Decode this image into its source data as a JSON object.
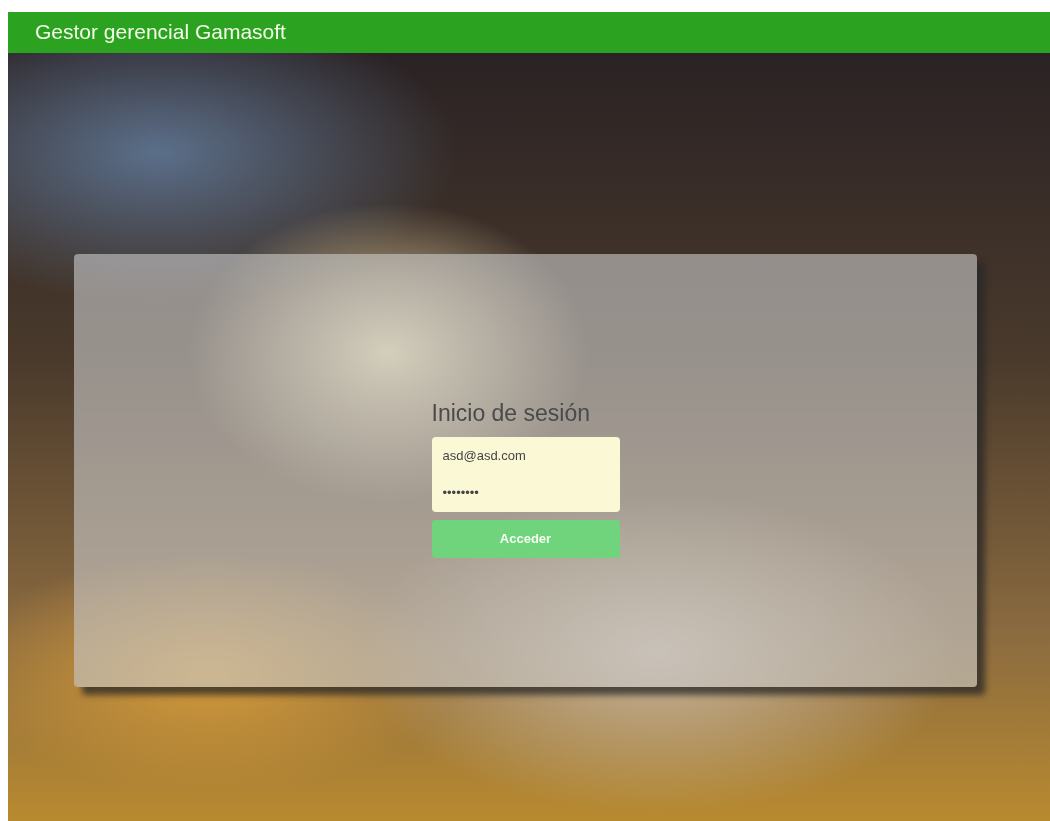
{
  "header": {
    "title": "Gestor gerencial Gamasoft"
  },
  "login": {
    "title": "Inicio de sesión",
    "email": {
      "value": "asd@asd.com"
    },
    "password": {
      "value": "••••••••"
    },
    "submit": {
      "label": "Acceder"
    }
  }
}
